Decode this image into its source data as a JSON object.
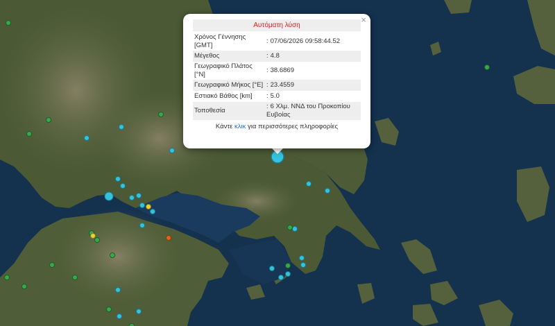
{
  "popup": {
    "title": "Αυτόματη λύση",
    "close_glyph": "×",
    "rows": [
      {
        "label": "Χρόνος Γέννησης [GMT]",
        "value": "07/06/2026 09:58:44.52"
      },
      {
        "label": "Μέγεθος",
        "value": "4.8"
      },
      {
        "label": "Γεωγραφικό Πλάτος [°N]",
        "value": "38.6869"
      },
      {
        "label": "Γεωγραφικό Μήκος [°E]",
        "value": "23.4559"
      },
      {
        "label": "Εστιακό Βάθος [km]",
        "value": "5.0"
      },
      {
        "label": "Τοποθεσία",
        "value": "6 Χλμ. ΝΝΔ του Προκοπίου Ευβοίας"
      }
    ],
    "more_prefix": "Κάντε",
    "more_link": "κλικ",
    "more_suffix": "για περισσότερες πληροφορίες"
  },
  "colors": {
    "sea": "#14314e",
    "land": "#4b5a35",
    "mountain": "#6d6a52",
    "marker_cyan": "#35c2dc",
    "marker_green": "#39a84a",
    "marker_yellow": "#e3d23a",
    "marker_orange": "#e0651c",
    "title_red": "#e02020",
    "link_blue": "#1f6fd0"
  },
  "markers": [
    {
      "color": "cyan",
      "mag": "large"
    },
    {
      "color": "cyan",
      "mag": "large"
    },
    {
      "color": "cyan",
      "mag": "small"
    },
    {
      "color": "cyan",
      "mag": "small"
    },
    {
      "color": "cyan",
      "mag": "small"
    },
    {
      "color": "cyan",
      "mag": "small"
    },
    {
      "color": "cyan",
      "mag": "small"
    },
    {
      "color": "cyan",
      "mag": "small"
    },
    {
      "color": "cyan",
      "mag": "small"
    },
    {
      "color": "cyan",
      "mag": "small"
    },
    {
      "color": "cyan",
      "mag": "small"
    },
    {
      "color": "cyan",
      "mag": "small"
    },
    {
      "color": "cyan",
      "mag": "small"
    },
    {
      "color": "cyan",
      "mag": "small"
    },
    {
      "color": "cyan",
      "mag": "small"
    },
    {
      "color": "cyan",
      "mag": "small"
    },
    {
      "color": "cyan",
      "mag": "small"
    },
    {
      "color": "cyan",
      "mag": "small"
    },
    {
      "color": "cyan",
      "mag": "small"
    },
    {
      "color": "cyan",
      "mag": "small"
    },
    {
      "color": "cyan",
      "mag": "small"
    },
    {
      "color": "cyan",
      "mag": "small"
    },
    {
      "color": "cyan",
      "mag": "small"
    },
    {
      "color": "green",
      "mag": "small"
    },
    {
      "color": "green",
      "mag": "small"
    },
    {
      "color": "green",
      "mag": "small"
    },
    {
      "color": "green",
      "mag": "small"
    },
    {
      "color": "green",
      "mag": "small"
    },
    {
      "color": "green",
      "mag": "small"
    },
    {
      "color": "green",
      "mag": "small"
    },
    {
      "color": "green",
      "mag": "small"
    },
    {
      "color": "green",
      "mag": "small"
    },
    {
      "color": "green",
      "mag": "small"
    },
    {
      "color": "green",
      "mag": "small"
    },
    {
      "color": "green",
      "mag": "small"
    },
    {
      "color": "green",
      "mag": "small"
    },
    {
      "color": "green",
      "mag": "small"
    },
    {
      "color": "green",
      "mag": "small"
    },
    {
      "color": "green",
      "mag": "small"
    },
    {
      "color": "green",
      "mag": "small"
    },
    {
      "color": "yellow",
      "mag": "small"
    },
    {
      "color": "yellow",
      "mag": "small"
    },
    {
      "color": "orange",
      "mag": "small"
    }
  ]
}
